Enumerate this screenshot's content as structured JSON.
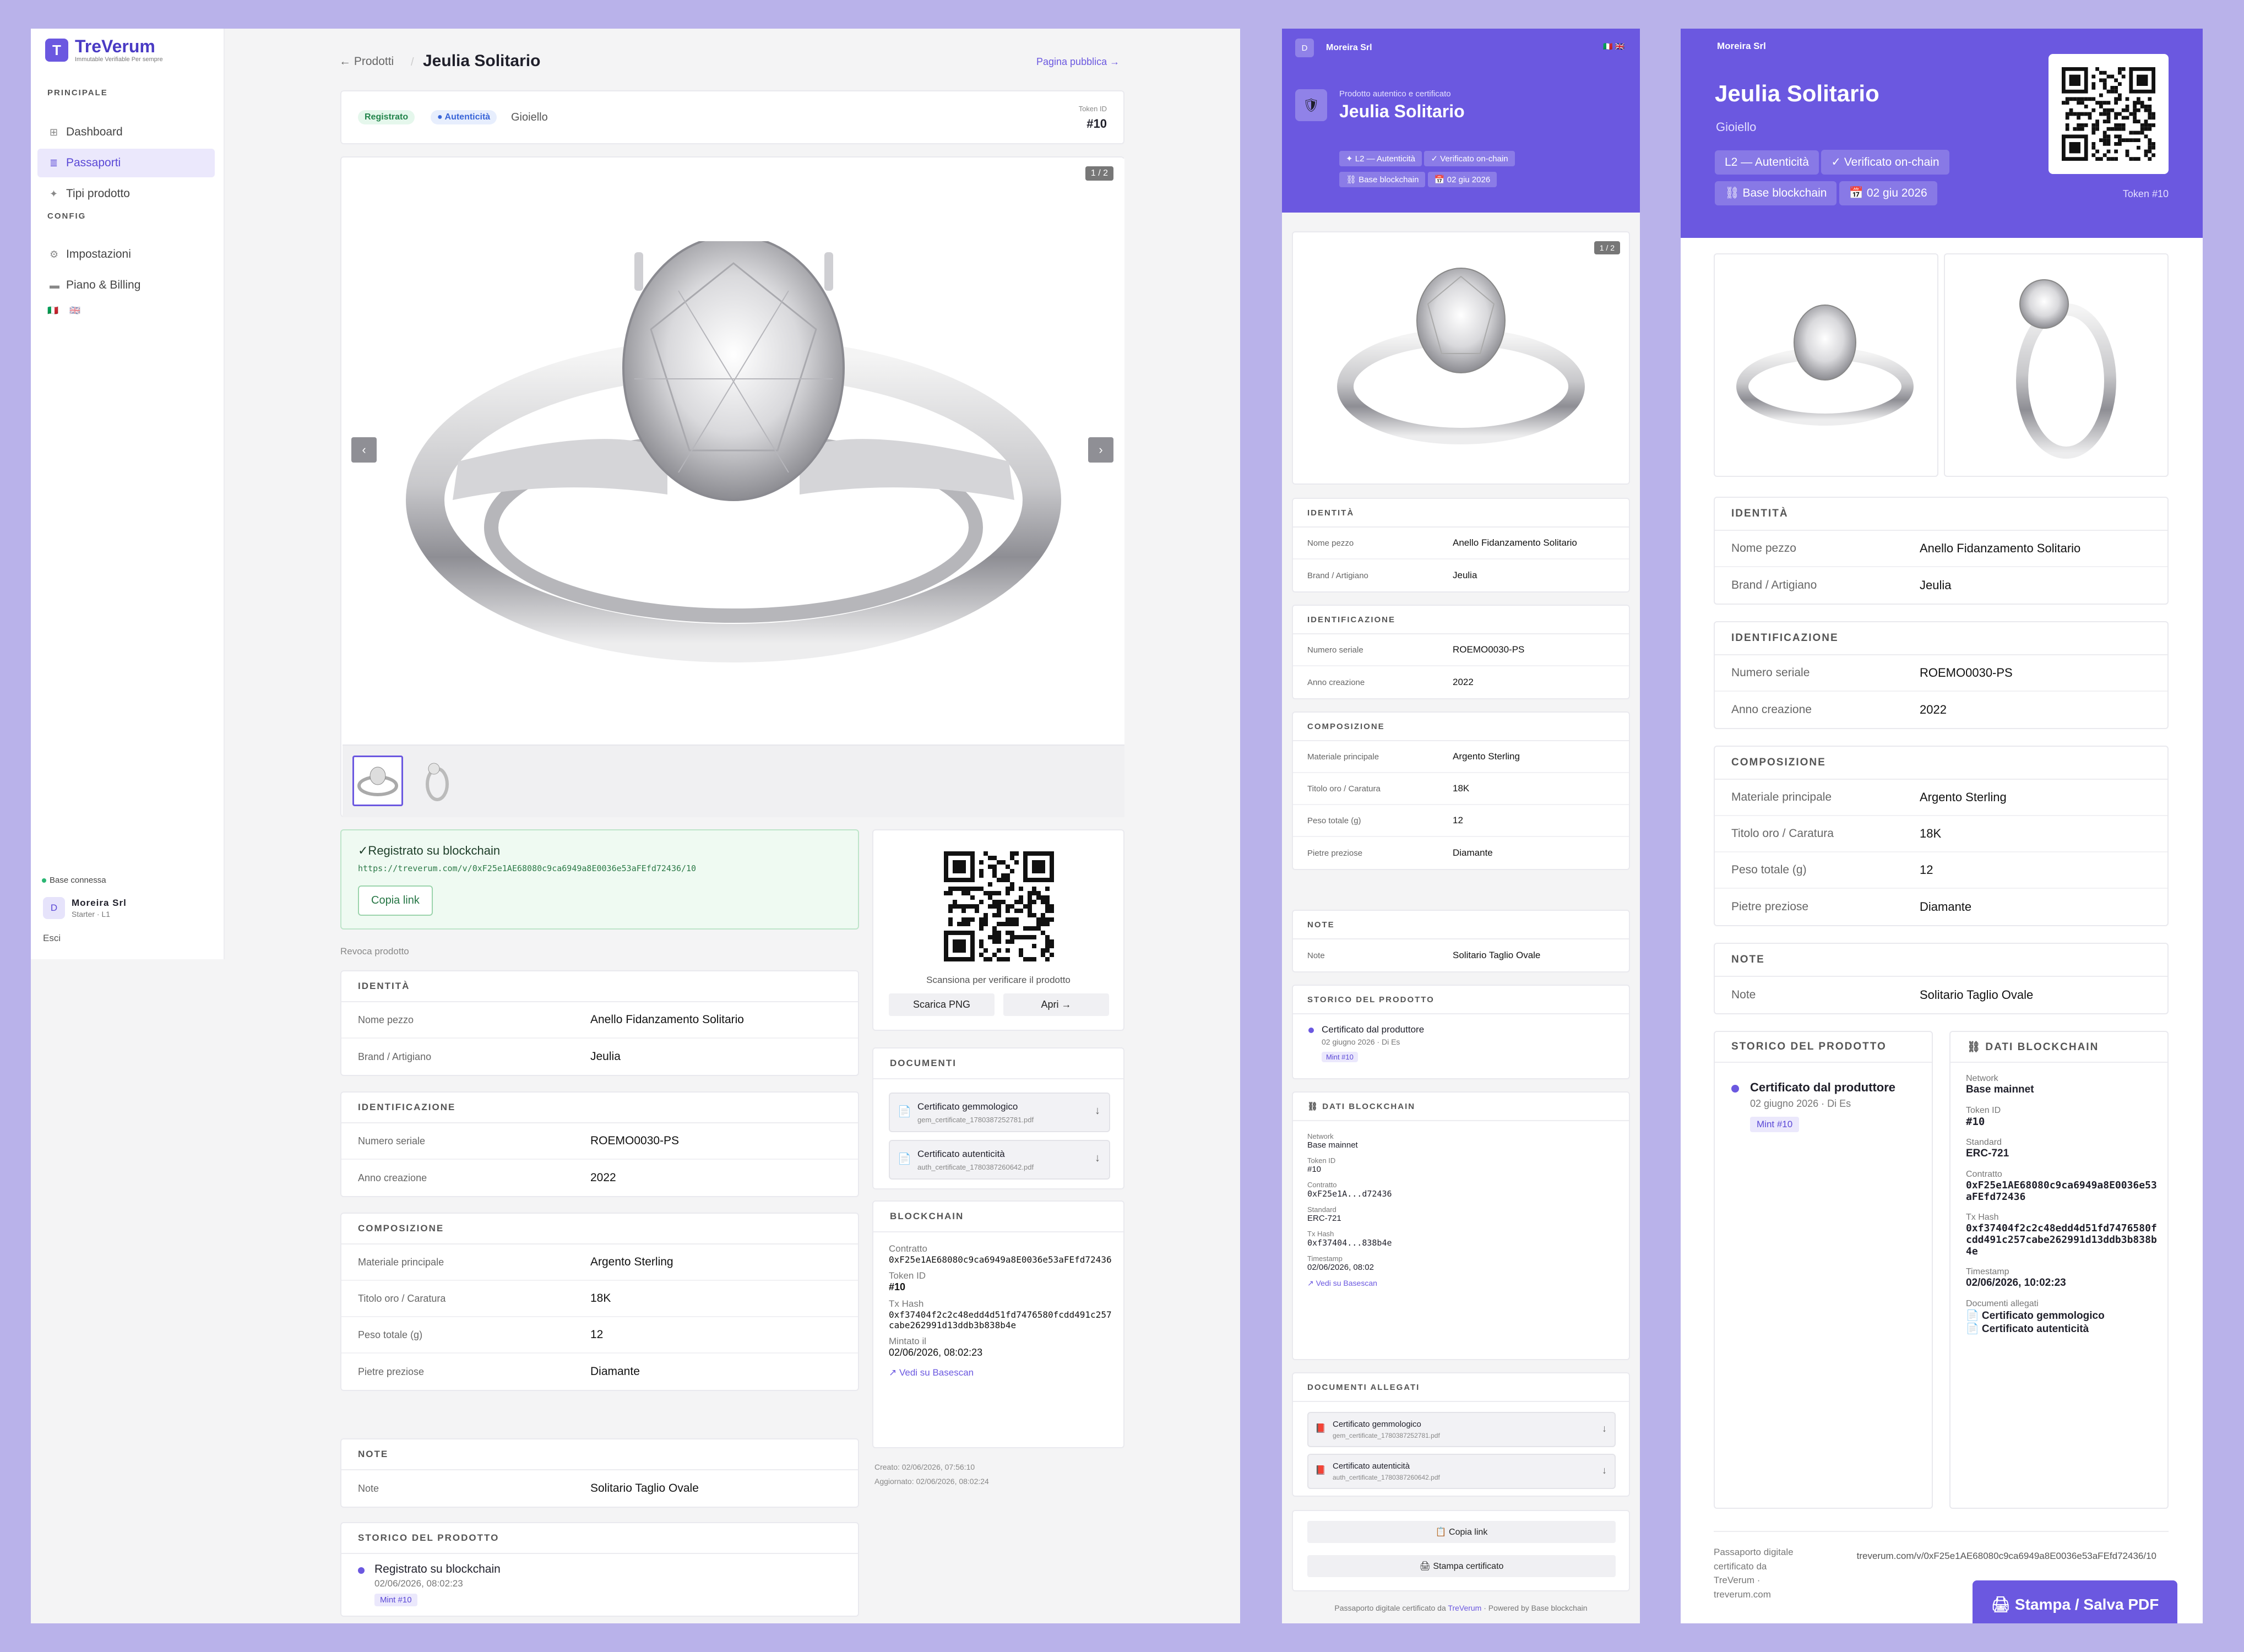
{
  "app": {
    "logo_title": "TreVerum",
    "logo_sub": "Immutable Verifiable Per sempre",
    "section_main": "PRINCIPALE",
    "nav": [
      {
        "label": "Dashboard",
        "icon": "grid-icon"
      },
      {
        "label": "Passaporti",
        "icon": "list-icon"
      },
      {
        "label": "Tipi prodotto",
        "icon": "sparkle-icon"
      }
    ],
    "section_config": "CONFIG",
    "nav_config": [
      {
        "label": "Impostazioni",
        "icon": "gear-icon"
      },
      {
        "label": "Piano & Billing",
        "icon": "card-icon"
      }
    ],
    "flags": [
      "🇮🇹",
      "🇬🇧"
    ],
    "connection": "Base connessa",
    "user": {
      "avatar": "D",
      "name": "Moreira Srl",
      "plan": "Starter · L1"
    },
    "logout": "Esci",
    "breadcrumb_back": "← Prodotti",
    "page_title": "Jeulia Solitario",
    "public_page_link": "Pagina pubblica →",
    "status": {
      "registered": "Registrato",
      "authenticity": "● Autenticità",
      "category": "Gioiello",
      "token_label": "Token ID",
      "token": "#10"
    },
    "gallery": {
      "counter": "1 / 2",
      "prev": "‹",
      "next": "›"
    },
    "blockchain_box": {
      "title": "✓Registrato su blockchain",
      "url": "https://treverum.com/v/0xF25e1AE68080c9ca6949a8E0036e53aFEfd72436/10",
      "copy": "Copia link"
    },
    "revoke": "Revoca prodotto",
    "qr": {
      "caption": "Scansiona per verificare il prodotto",
      "download": "Scarica PNG",
      "open": "Apri →"
    },
    "sections": [
      {
        "title": "IDENTITÀ",
        "rows": [
          {
            "k": "Nome pezzo",
            "v": "Anello Fidanzamento Solitario"
          },
          {
            "k": "Brand / Artigiano",
            "v": "Jeulia"
          }
        ]
      },
      {
        "title": "IDENTIFICAZIONE",
        "rows": [
          {
            "k": "Numero seriale",
            "v": "ROEMO0030-PS"
          },
          {
            "k": "Anno creazione",
            "v": "2022"
          }
        ]
      },
      {
        "title": "COMPOSIZIONE",
        "rows": [
          {
            "k": "Materiale principale",
            "v": "Argento Sterling"
          },
          {
            "k": "Titolo oro / Caratura",
            "v": "18K"
          },
          {
            "k": "Peso totale (g)",
            "v": "12"
          },
          {
            "k": "Pietre preziose",
            "v": "Diamante"
          }
        ]
      },
      {
        "title": "NOTE",
        "rows": [
          {
            "k": "Note",
            "v": "Solitario Taglio Ovale"
          }
        ]
      }
    ],
    "history": {
      "title": "STORICO DEL PRODOTTO",
      "event": "Registrato su blockchain",
      "date": "02/06/2026, 08:02:23",
      "mint": "Mint #10"
    },
    "documents": {
      "title": "DOCUMENTI",
      "items": [
        {
          "name": "Certificato gemmologico",
          "file": "gem_certificate_1780387252781.pdf"
        },
        {
          "name": "Certificato autenticità",
          "file": "auth_certificate_1780387260642.pdf"
        }
      ]
    },
    "chain": {
      "title": "BLOCKCHAIN",
      "contract_label": "Contratto",
      "contract": "0xF25e1AE68080c9ca6949a8E0036e53aFEfd72436",
      "token_label": "Token ID",
      "token": "#10",
      "tx_label": "Tx Hash",
      "tx": "0xf37404f2c2c48edd4d51fd7476580fcdd491c257cabe262991d13ddb3b838b4e",
      "minted_label": "Mintato il",
      "minted": "02/06/2026, 08:02:23",
      "explorer": "↗ Vedi su Basescan"
    },
    "created": "Creato: 02/06/2026, 07:56:10",
    "updated": "Aggiornato: 02/06/2026, 08:02:24"
  },
  "mobile": {
    "brand_avatar": "D",
    "brand": "Moreira Srl",
    "flags": "🇮🇹 🇬🇧",
    "kicker": "Prodotto autentico e certificato",
    "title": "Jeulia Solitario",
    "tags": [
      "✦ L2 — Autenticità",
      "✓ Verificato on-chain",
      "⛓ Base blockchain",
      "📅 02 giu 2026"
    ],
    "counter": "1 / 2",
    "sections": [
      {
        "title": "IDENTITÀ",
        "rows": [
          {
            "k": "Nome pezzo",
            "v": "Anello Fidanzamento Solitario"
          },
          {
            "k": "Brand / Artigiano",
            "v": "Jeulia"
          }
        ]
      },
      {
        "title": "IDENTIFICAZIONE",
        "rows": [
          {
            "k": "Numero seriale",
            "v": "ROEMO0030-PS"
          },
          {
            "k": "Anno creazione",
            "v": "2022"
          }
        ]
      },
      {
        "title": "COMPOSIZIONE",
        "rows": [
          {
            "k": "Materiale principale",
            "v": "Argento Sterling"
          },
          {
            "k": "Titolo oro / Caratura",
            "v": "18K"
          },
          {
            "k": "Peso totale (g)",
            "v": "12"
          },
          {
            "k": "Pietre preziose",
            "v": "Diamante"
          }
        ]
      },
      {
        "title": "NOTE",
        "rows": [
          {
            "k": "Note",
            "v": "Solitario Taglio Ovale"
          }
        ]
      }
    ],
    "history": {
      "title": "STORICO DEL PRODOTTO",
      "event": "Certificato dal produttore",
      "date": "02 giugno 2026 · Di Es",
      "mint": "Mint #10"
    },
    "chain": {
      "title": "⛓ DATI BLOCKCHAIN",
      "items": [
        {
          "k": "Network",
          "v": "Base mainnet"
        },
        {
          "k": "Token ID",
          "v": "#10"
        },
        {
          "k": "Contratto",
          "v": "0xF25e1A...d72436"
        },
        {
          "k": "Standard",
          "v": "ERC-721"
        },
        {
          "k": "Tx Hash",
          "v": "0xf37404...838b4e"
        },
        {
          "k": "Timestamp",
          "v": "02/06/2026, 08:02"
        }
      ],
      "explorer": "↗ Vedi su Basescan"
    },
    "docs": {
      "title": "DOCUMENTI ALLEGATI",
      "items": [
        {
          "name": "Certificato gemmologico",
          "file": "gem_certificate_1780387252781.pdf"
        },
        {
          "name": "Certificato autenticità",
          "file": "auth_certificate_1780387260642.pdf"
        }
      ]
    },
    "copy_link": "📋 Copia link",
    "print": "🖨 Stampa certificato",
    "footer_pre": "Passaporto digitale certificato da ",
    "footer_link": "TreVerum",
    "footer_post": " · Powered by Base blockchain"
  },
  "print": {
    "brand": "Moreira Srl",
    "title": "Jeulia Solitario",
    "subtitle": "Gioiello",
    "tags": [
      "L2 — Autenticità",
      "✓ Verificato on-chain",
      "⛓ Base blockchain",
      "📅 02 giu 2026"
    ],
    "token": "Token #10",
    "sections": [
      {
        "title": "IDENTITÀ",
        "rows": [
          {
            "k": "Nome pezzo",
            "v": "Anello Fidanzamento Solitario"
          },
          {
            "k": "Brand / Artigiano",
            "v": "Jeulia"
          }
        ]
      },
      {
        "title": "IDENTIFICAZIONE",
        "rows": [
          {
            "k": "Numero seriale",
            "v": "ROEMO0030-PS"
          },
          {
            "k": "Anno creazione",
            "v": "2022"
          }
        ]
      },
      {
        "title": "COMPOSIZIONE",
        "rows": [
          {
            "k": "Materiale principale",
            "v": "Argento Sterling"
          },
          {
            "k": "Titolo oro / Caratura",
            "v": "18K"
          },
          {
            "k": "Peso totale (g)",
            "v": "12"
          },
          {
            "k": "Pietre preziose",
            "v": "Diamante"
          }
        ]
      },
      {
        "title": "NOTE",
        "rows": [
          {
            "k": "Note",
            "v": "Solitario Taglio Ovale"
          }
        ]
      }
    ],
    "history": {
      "title": "STORICO DEL PRODOTTO",
      "event": "Certificato dal produttore",
      "date": "02 giugno 2026 · Di Es",
      "mint": "Mint #10"
    },
    "chain": {
      "title": "⛓ DATI BLOCKCHAIN",
      "items": [
        {
          "k": "Network",
          "v": "Base mainnet"
        },
        {
          "k": "Token ID",
          "v": "#10"
        },
        {
          "k": "Standard",
          "v": "ERC-721"
        },
        {
          "k": "Contratto",
          "v": "0xF25e1AE68080c9ca6949a8E0036e53aFEfd72436"
        },
        {
          "k": "Tx Hash",
          "v": "0xf37404f2c2c48edd4d51fd7476580fcdd491c257cabe262991d13ddb3b838b4e"
        },
        {
          "k": "Timestamp",
          "v": "02/06/2026, 10:02:23"
        }
      ],
      "docs_label": "Documenti allegati",
      "docs": [
        "📄 Certificato gemmologico",
        "📄 Certificato autenticità"
      ]
    },
    "footer_text": "Passaporto digitale certificato da TreVerum · treverum.com",
    "footer_url": "treverum.com/v/0xF25e1AE68080c9ca6949a8E0036e53aFEfd72436/10",
    "print_button": "🖨 Stampa / Salva PDF"
  },
  "colors": {
    "accent": "#6b58e0",
    "background": "#b9b2ea",
    "success": "#22844b"
  }
}
